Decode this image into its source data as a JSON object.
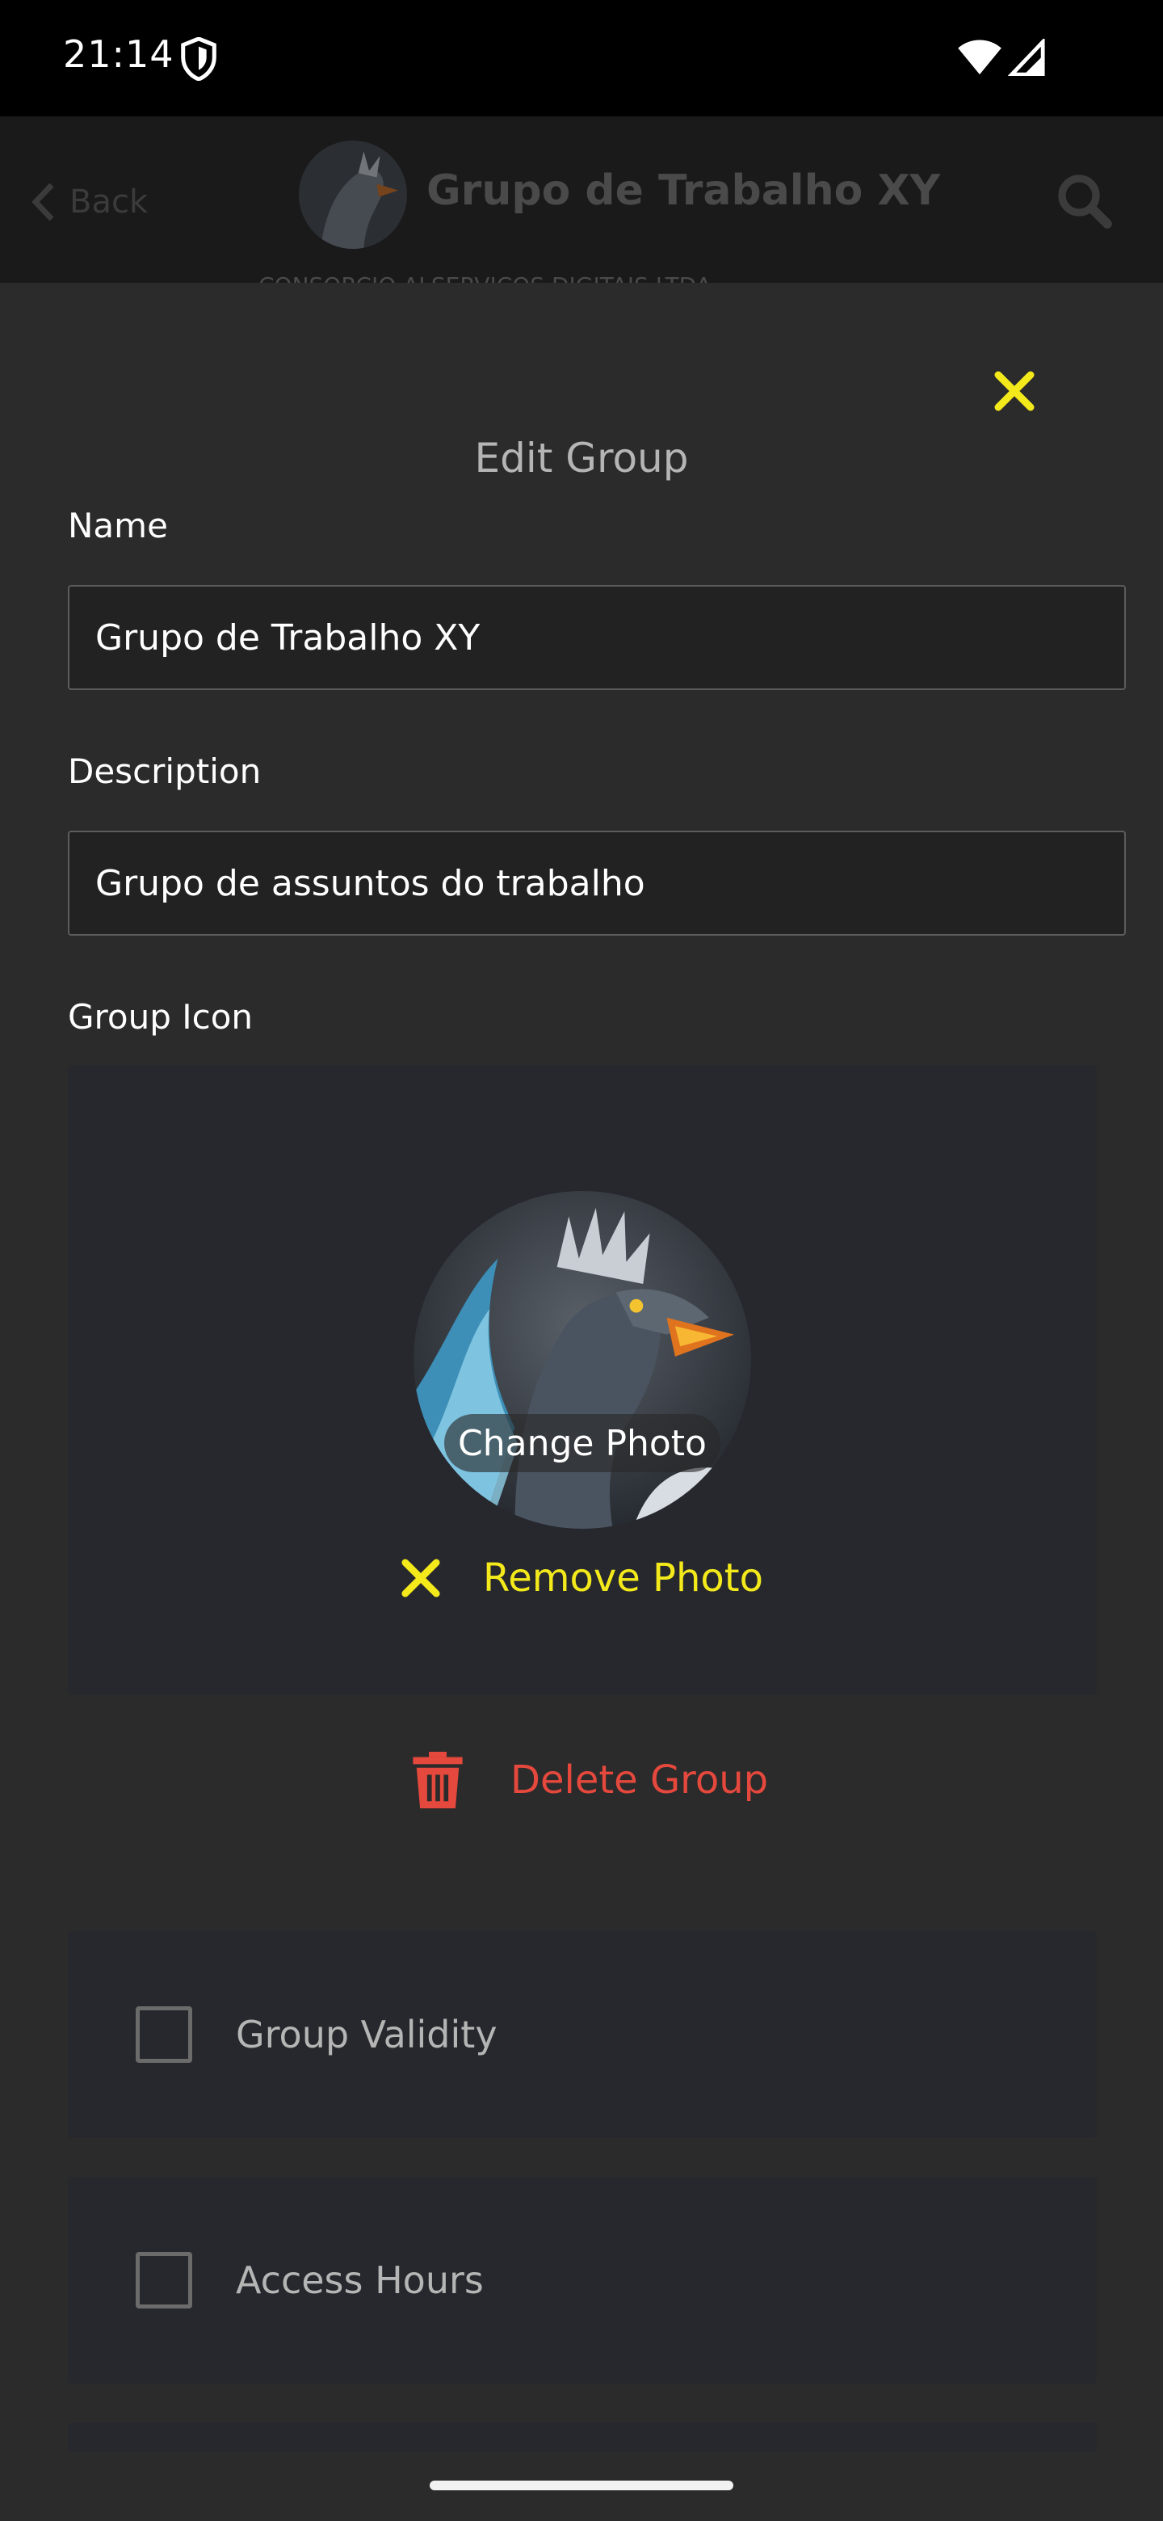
{
  "status_bar": {
    "time": "21:14",
    "icons": [
      "shield-icon",
      "wifi-icon",
      "signal-icon"
    ]
  },
  "app_header": {
    "back_label": "Back",
    "group_title": "Grupo de Trabalho XY",
    "subtitle": "CONSORCIO ALSERVICOS DIGITAIS LTDA",
    "search_icon": "search-icon"
  },
  "modal": {
    "title": "Edit Group",
    "name_label": "Name",
    "name_value": "Grupo de Trabalho XY",
    "description_label": "Description",
    "description_value": "Grupo de assuntos do trabalho",
    "group_icon_label": "Group Icon",
    "change_photo_label": "Change Photo",
    "remove_photo_label": "Remove Photo",
    "delete_group_label": "Delete Group",
    "options": [
      {
        "label": "Group Validity",
        "checked": false
      },
      {
        "label": "Access Hours",
        "checked": false
      }
    ]
  },
  "colors": {
    "accent_yellow": "#f4ea1b",
    "danger_red": "#e5483c",
    "panel_bg": "#27282d",
    "modal_bg": "#2b2b2b"
  }
}
